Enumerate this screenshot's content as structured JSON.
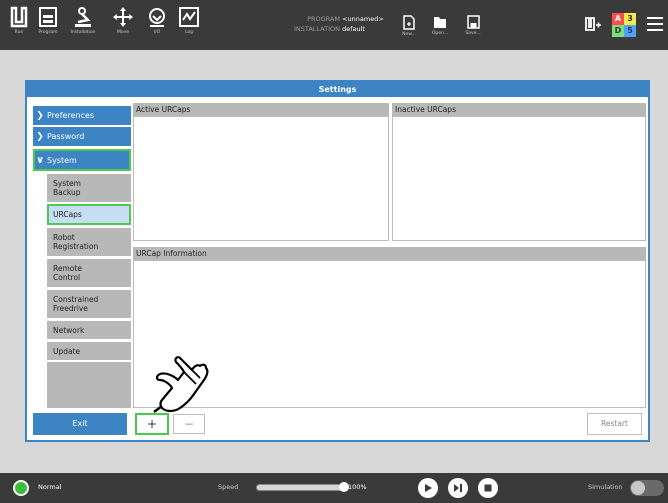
{
  "nav": {
    "run": "Run",
    "program": "Program",
    "installation": "Installation",
    "move": "Move",
    "io": "I/O",
    "log": "Log"
  },
  "program_info": {
    "program_label": "PROGRAM",
    "program_value": "<unnamed>",
    "installation_label": "INSTALLATION",
    "installation_value": "default"
  },
  "file_actions": {
    "new": "New...",
    "open": "Open...",
    "save": "Save..."
  },
  "mode_indicator": {
    "cells": [
      "A",
      "3",
      "D",
      "5"
    ],
    "colors": [
      "#ff4d4d",
      "#f5e84a",
      "#7be07b",
      "#4da3ff"
    ]
  },
  "settings": {
    "title": "Settings",
    "sidebar": {
      "preferences": "Preferences",
      "password": "Password",
      "system": "System",
      "sub_items": [
        "System\nBackup",
        "URCaps",
        "Robot\nRegistration",
        "Remote\nControl",
        "Constrained\nFreedrive",
        "Network",
        "Update"
      ]
    },
    "exit": "Exit",
    "active_urcaps": "Active URCaps",
    "inactive_urcaps": "Inactive URCaps",
    "urcap_information": "URCap Information",
    "add": "+",
    "remove": "−",
    "restart": "Restart"
  },
  "status": {
    "mode": "Normal",
    "speed_label": "Speed",
    "speed_value": "100%",
    "speed_fraction": 1.0,
    "simulation_label": "Simulation"
  },
  "colors": {
    "accent": "#3d84c5",
    "highlight": "#4ec94e",
    "status_ok": "#3bbf3b"
  }
}
